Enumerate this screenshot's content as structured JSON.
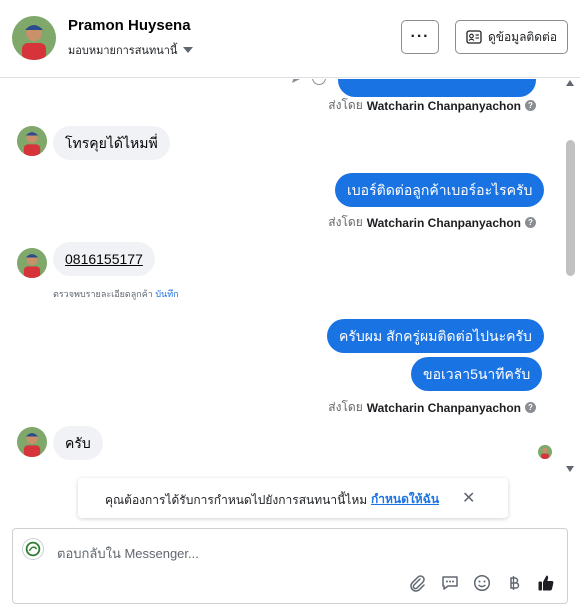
{
  "header": {
    "name": "Pramon Huysena",
    "assign_label": "มอบหมายการสนทนานี้",
    "more_label": "···",
    "contact_label": "ดูข้อมูลติดต่อ"
  },
  "messages": {
    "sent_prefix": "ส่งโดย",
    "agent": "Watcharin Chanpanyachon",
    "m1": "โทรคุยได้ไหมพี่",
    "m2": "เบอร์ติดต่อลูกค้าเบอร์อะไรครับ",
    "m3": "0816155177",
    "note_text": "ตรวจพบรายละเอียดลูกค้า",
    "note_link": "บันทึก",
    "m4": "ครับผม สักครู่ผมติดต่อไปนะครับ",
    "m5": "ขอเวลา5นาทีครับ",
    "m6": "ครับ"
  },
  "notice": {
    "text": "คุณต้องการได้รับการกำหนดไปยังการสนทนานี้ไหม",
    "link": "กำหนดให้ฉัน",
    "close": "✕"
  },
  "composer": {
    "placeholder": "ตอบกลับใน Messenger..."
  },
  "colors": {
    "accent": "#1a73e3",
    "incoming_bubble": "#f0f2f5"
  }
}
